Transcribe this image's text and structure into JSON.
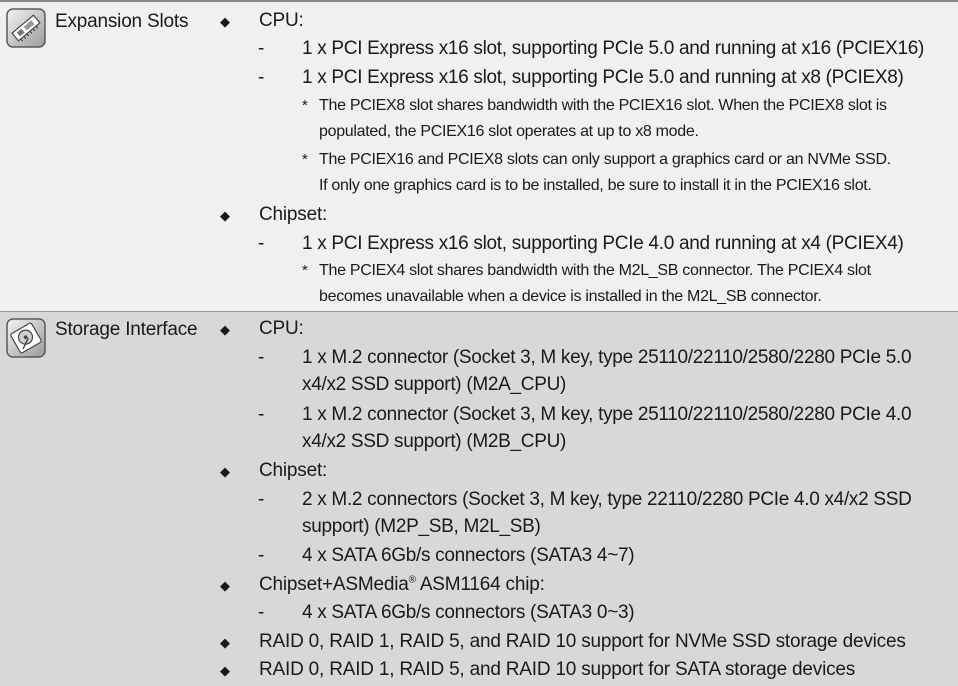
{
  "rows": [
    {
      "label": "Expansion Slots",
      "icon": "expansion-card-icon"
    },
    {
      "label": "Storage Interface",
      "icon": "hard-drive-icon"
    }
  ],
  "expansion": {
    "cpu_heading": "CPU:",
    "cpu_item1": "1 x PCI Express x16 slot, supporting PCIe 5.0 and running at x16 (PCIEX16)",
    "cpu_item2": "1 x PCI Express x16 slot, supporting PCIe 5.0 and running at x8 (PCIEX8)",
    "note1_line1": "The PCIEX8 slot shares bandwidth with the PCIEX16 slot. When the PCIEX8 slot is",
    "note1_line2": "populated, the PCIEX16 slot operates at up to x8 mode.",
    "note2_line1": "The PCIEX16 and PCIEX8 slots can only support a graphics card or an NVMe SSD.",
    "note2_line2": "If only one graphics card is to be installed, be sure to install it in the PCIEX16 slot.",
    "chipset_heading": "Chipset:",
    "chipset_item1": "1 x PCI Express x16 slot, supporting PCIe 4.0 and running at x4 (PCIEX4)",
    "note3_line1": "The PCIEX4 slot shares bandwidth with the M2L_SB connector. The PCIEX4 slot",
    "note3_line2": "becomes unavailable when a device is installed in the M2L_SB connector."
  },
  "storage": {
    "cpu_heading": "CPU:",
    "cpu_item1_line1": "1 x M.2 connector (Socket 3, M key, type 25110/22110/2580/2280 PCIe 5.0",
    "cpu_item1_line2": "x4/x2 SSD support) (M2A_CPU)",
    "cpu_item2_line1": "1 x M.2 connector (Socket 3, M key, type 25110/22110/2580/2280 PCIe 4.0",
    "cpu_item2_line2": "x4/x2 SSD support) (M2B_CPU)",
    "chipset_heading": "Chipset:",
    "chipset_item1_line1": "2 x M.2 connectors (Socket 3, M key, type 22110/2280 PCIe 4.0 x4/x2 SSD",
    "chipset_item1_line2": "support) (M2P_SB, M2L_SB)",
    "chipset_item2": "4 x SATA 6Gb/s connectors (SATA3 4~7)",
    "asm_heading_prefix": "Chipset+ASMedia",
    "asm_heading_reg": "®",
    "asm_heading_suffix": " ASM1164 chip:",
    "asm_item1": "4 x SATA 6Gb/s connectors (SATA3 0~3)",
    "raid_nvme": "RAID 0, RAID 1, RAID 5, and RAID 10 support for NVMe SSD storage devices",
    "raid_sata": "RAID 0, RAID 1, RAID 5, and RAID 10 support for SATA storage devices"
  },
  "symbols": {
    "bullet": "◆",
    "dash": "-",
    "star": "*"
  }
}
